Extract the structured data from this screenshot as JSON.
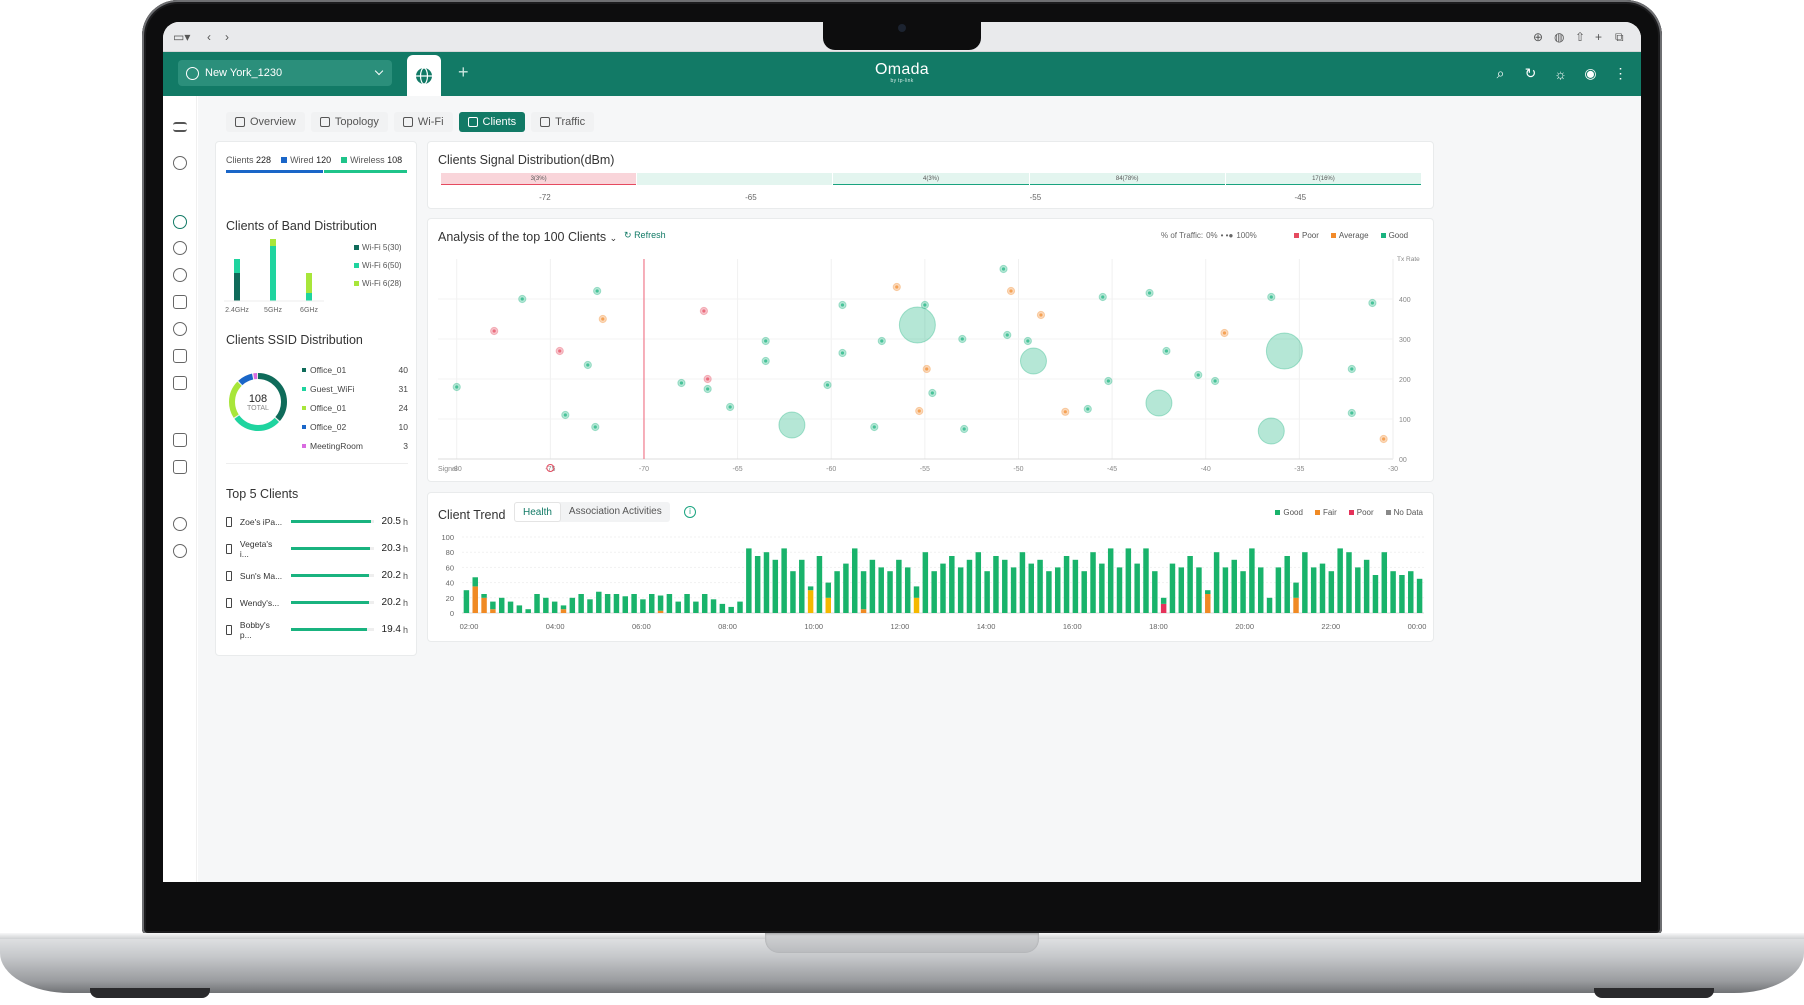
{
  "browser": {
    "controls_left": [
      "sidebar-toggle",
      "back",
      "forward"
    ],
    "controls_right": [
      "download",
      "shield",
      "share",
      "new-tab",
      "tabs"
    ]
  },
  "header": {
    "site": "New York_1230",
    "brand": "Omada",
    "brand_sub": "by tp-link",
    "plus": "+"
  },
  "tabs": [
    {
      "label": "Overview",
      "icon": "grid-icon",
      "active": false
    },
    {
      "label": "Topology",
      "icon": "topology-icon",
      "active": false
    },
    {
      "label": "Wi-Fi",
      "icon": "wifi-icon",
      "active": false
    },
    {
      "label": "Clients",
      "icon": "clients-icon",
      "active": true
    },
    {
      "label": "Traffic",
      "icon": "traffic-icon",
      "active": false
    }
  ],
  "summary": {
    "clients_label": "Clients",
    "clients": "228",
    "wired_label": "Wired",
    "wired": "120",
    "wireless_label": "Wireless",
    "wireless": "108"
  },
  "band": {
    "title": "Clients of Band Distribution",
    "legend": [
      {
        "label": "Wi-Fi 5(30)",
        "color": "#0f6b5a"
      },
      {
        "label": "Wi-Fi 6(50)",
        "color": "#1fd49f"
      },
      {
        "label": "Wi-Fi 6(28)",
        "color": "#a8e63a"
      }
    ],
    "bands": [
      "2.4GHz",
      "5GHz",
      "6GHz"
    ]
  },
  "ssid": {
    "title": "Clients SSID Distribution",
    "total": "108",
    "total_label": "TOTAL",
    "items": [
      {
        "name": "Office_01",
        "value": "40",
        "color": "#0f6b5a"
      },
      {
        "name": "Guest_WiFi",
        "value": "31",
        "color": "#1fd49f"
      },
      {
        "name": "Office_01",
        "value": "24",
        "color": "#a8e63a"
      },
      {
        "name": "Office_02",
        "value": "10",
        "color": "#1a66c8"
      },
      {
        "name": "MeetingRoom",
        "value": "3",
        "color": "#d96be0"
      }
    ]
  },
  "top5": {
    "title": "Top 5 Clients",
    "items": [
      {
        "name": "Zoe's iPa...",
        "value": "20.5",
        "unit": "h",
        "fill": 0.97
      },
      {
        "name": "Vegeta's i...",
        "value": "20.3",
        "unit": "h",
        "fill": 0.96
      },
      {
        "name": "Sun's Ma...",
        "value": "20.2",
        "unit": "h",
        "fill": 0.95
      },
      {
        "name": "Wendy's...",
        "value": "20.2",
        "unit": "h",
        "fill": 0.95
      },
      {
        "name": "Bobby's p...",
        "value": "19.4",
        "unit": "h",
        "fill": 0.92
      }
    ]
  },
  "signal": {
    "title": "Clients Signal Distribution(dBm)",
    "segments": [
      {
        "label": "3(3%)",
        "color": "#f9d5da",
        "line": "#e54a5f"
      },
      {
        "label": "",
        "color": "#e3f5ef",
        "line": "#e3f5ef"
      },
      {
        "label": "4(3%)",
        "color": "#e3f5ef",
        "line": "#19a37f"
      },
      {
        "label": "84(78%)",
        "color": "#e3f5ef",
        "line": "#19a37f"
      },
      {
        "label": "17(16%)",
        "color": "#e3f5ef",
        "line": "#19a37f"
      }
    ],
    "ticks": [
      "-72",
      "-65",
      "-55",
      "-45"
    ]
  },
  "scatter": {
    "title": "Analysis of the top 100 Clients",
    "refresh": "Refresh",
    "traffic_label": "% of Traffic:",
    "traffic_min": "0%",
    "traffic_max": "100%",
    "legend": [
      {
        "label": "Poor",
        "color": "#e54a5f"
      },
      {
        "label": "Average",
        "color": "#f28a2a"
      },
      {
        "label": "Good",
        "color": "#19b37f"
      }
    ],
    "x_label": "Signal",
    "y_label": "Tx Rate",
    "x_ticks": [
      "-80",
      "-75",
      "-70",
      "-65",
      "-60",
      "-55",
      "-50",
      "-45",
      "-40",
      "-35",
      "-30"
    ],
    "y_ticks": [
      "00",
      "100",
      "200",
      "300",
      "400"
    ]
  },
  "chart_data": {
    "type": "scatter",
    "title": "Analysis of the top 100 Clients",
    "xlabel": "Signal",
    "ylabel": "Tx Rate",
    "xlim": [
      -81,
      -30
    ],
    "ylim": [
      0,
      500
    ],
    "threshold_x": -70,
    "points": [
      {
        "x": -80,
        "y": 180,
        "s": 1,
        "q": "good"
      },
      {
        "x": -76.5,
        "y": 400,
        "s": 1,
        "q": "good"
      },
      {
        "x": -78,
        "y": 320,
        "s": 1,
        "q": "poor"
      },
      {
        "x": -74.5,
        "y": 270,
        "s": 1,
        "q": "poor"
      },
      {
        "x": -74.2,
        "y": 110,
        "s": 1,
        "q": "good"
      },
      {
        "x": -73,
        "y": 235,
        "s": 1,
        "q": "good"
      },
      {
        "x": -72.5,
        "y": 420,
        "s": 1,
        "q": "good"
      },
      {
        "x": -72.2,
        "y": 350,
        "s": 1,
        "q": "average"
      },
      {
        "x": -72.6,
        "y": 80,
        "s": 1,
        "q": "good"
      },
      {
        "x": -68,
        "y": 190,
        "s": 1,
        "q": "good"
      },
      {
        "x": -66.8,
        "y": 370,
        "s": 1,
        "q": "poor"
      },
      {
        "x": -66.6,
        "y": 200,
        "s": 1,
        "q": "poor"
      },
      {
        "x": -66.6,
        "y": 175,
        "s": 1,
        "q": "good"
      },
      {
        "x": -65.4,
        "y": 130,
        "s": 1,
        "q": "good"
      },
      {
        "x": -63.5,
        "y": 295,
        "s": 1,
        "q": "good"
      },
      {
        "x": -63.5,
        "y": 245,
        "s": 1,
        "q": "good"
      },
      {
        "x": -62.1,
        "y": 85,
        "s": 3,
        "q": "good"
      },
      {
        "x": -60.2,
        "y": 185,
        "s": 1,
        "q": "good"
      },
      {
        "x": -59.4,
        "y": 385,
        "s": 1,
        "q": "good"
      },
      {
        "x": -59.4,
        "y": 265,
        "s": 1,
        "q": "good"
      },
      {
        "x": -57.3,
        "y": 295,
        "s": 1,
        "q": "good"
      },
      {
        "x": -57.7,
        "y": 80,
        "s": 1,
        "q": "good"
      },
      {
        "x": -56.5,
        "y": 430,
        "s": 1,
        "q": "average"
      },
      {
        "x": -55.4,
        "y": 335,
        "s": 4,
        "q": "good"
      },
      {
        "x": -55,
        "y": 385,
        "s": 1,
        "q": "good"
      },
      {
        "x": -54.9,
        "y": 225,
        "s": 1,
        "q": "average"
      },
      {
        "x": -55.3,
        "y": 120,
        "s": 1,
        "q": "average"
      },
      {
        "x": -54.6,
        "y": 165,
        "s": 1,
        "q": "good"
      },
      {
        "x": -53,
        "y": 300,
        "s": 1,
        "q": "good"
      },
      {
        "x": -52.9,
        "y": 75,
        "s": 1,
        "q": "good"
      },
      {
        "x": -50.8,
        "y": 475,
        "s": 1,
        "q": "good"
      },
      {
        "x": -50.6,
        "y": 310,
        "s": 1,
        "q": "good"
      },
      {
        "x": -50.4,
        "y": 420,
        "s": 1,
        "q": "average"
      },
      {
        "x": -48.8,
        "y": 360,
        "s": 1,
        "q": "average"
      },
      {
        "x": -49.5,
        "y": 295,
        "s": 1,
        "q": "good"
      },
      {
        "x": -49.2,
        "y": 245,
        "s": 3,
        "q": "good"
      },
      {
        "x": -47.5,
        "y": 118,
        "s": 1,
        "q": "average"
      },
      {
        "x": -46.3,
        "y": 125,
        "s": 1,
        "q": "good"
      },
      {
        "x": -45.5,
        "y": 405,
        "s": 1,
        "q": "good"
      },
      {
        "x": -45.2,
        "y": 195,
        "s": 1,
        "q": "good"
      },
      {
        "x": -42.5,
        "y": 140,
        "s": 3,
        "q": "good"
      },
      {
        "x": -42.1,
        "y": 270,
        "s": 1,
        "q": "good"
      },
      {
        "x": -43,
        "y": 415,
        "s": 1,
        "q": "good"
      },
      {
        "x": -40.4,
        "y": 210,
        "s": 1,
        "q": "good"
      },
      {
        "x": -39.5,
        "y": 195,
        "s": 1,
        "q": "good"
      },
      {
        "x": -39,
        "y": 315,
        "s": 1,
        "q": "average"
      },
      {
        "x": -36.5,
        "y": 405,
        "s": 1,
        "q": "good"
      },
      {
        "x": -36.5,
        "y": 70,
        "s": 3,
        "q": "good"
      },
      {
        "x": -35.8,
        "y": 270,
        "s": 4,
        "q": "good"
      },
      {
        "x": -32.2,
        "y": 225,
        "s": 1,
        "q": "good"
      },
      {
        "x": -32.2,
        "y": 115,
        "s": 1,
        "q": "good"
      },
      {
        "x": -31.1,
        "y": 390,
        "s": 1,
        "q": "good"
      },
      {
        "x": -30.5,
        "y": 50,
        "s": 1,
        "q": "average"
      }
    ]
  },
  "trend": {
    "title": "Client Trend",
    "tabs": [
      {
        "label": "Health",
        "active": true
      },
      {
        "label": "Association Activities",
        "active": false
      }
    ],
    "legend": [
      {
        "label": "Good",
        "color": "#19b36b"
      },
      {
        "label": "Fair",
        "color": "#f08a24"
      },
      {
        "label": "Poor",
        "color": "#e5325a"
      },
      {
        "label": "No Data",
        "color": "#888"
      }
    ],
    "y_ticks": [
      "100",
      "80",
      "60",
      "40",
      "20",
      "0"
    ],
    "x_ticks": [
      "02:00",
      "04:00",
      "06:00",
      "08:00",
      "10:00",
      "12:00",
      "14:00",
      "16:00",
      "18:00",
      "20:00",
      "22:00",
      "00:00"
    ],
    "bars": [
      {
        "g": 30,
        "f": 0,
        "y": 0,
        "p": 0
      },
      {
        "g": 12,
        "f": 35,
        "y": 0,
        "p": 0
      },
      {
        "g": 5,
        "f": 20,
        "y": 0,
        "p": 0
      },
      {
        "g": 10,
        "f": 5,
        "y": 0,
        "p": 0
      },
      {
        "g": 20,
        "f": 0,
        "y": 0,
        "p": 0
      },
      {
        "g": 15,
        "f": 0,
        "y": 0,
        "p": 0
      },
      {
        "g": 10,
        "f": 0,
        "y": 0,
        "p": 0
      },
      {
        "g": 5,
        "f": 0,
        "y": 0,
        "p": 0
      },
      {
        "g": 25,
        "f": 0,
        "y": 0,
        "p": 0
      },
      {
        "g": 20,
        "f": 0,
        "y": 0,
        "p": 0
      },
      {
        "g": 15,
        "f": 0,
        "y": 0,
        "p": 0
      },
      {
        "g": 5,
        "f": 5,
        "y": 0,
        "p": 0
      },
      {
        "g": 20,
        "f": 0,
        "y": 0,
        "p": 0
      },
      {
        "g": 25,
        "f": 0,
        "y": 0,
        "p": 0
      },
      {
        "g": 18,
        "f": 0,
        "y": 0,
        "p": 0
      },
      {
        "g": 28,
        "f": 0,
        "y": 0,
        "p": 0
      },
      {
        "g": 25,
        "f": 0,
        "y": 0,
        "p": 0
      },
      {
        "g": 25,
        "f": 0,
        "y": 0,
        "p": 0
      },
      {
        "g": 22,
        "f": 0,
        "y": 0,
        "p": 0
      },
      {
        "g": 25,
        "f": 0,
        "y": 0,
        "p": 0
      },
      {
        "g": 18,
        "f": 0,
        "y": 0,
        "p": 0
      },
      {
        "g": 25,
        "f": 0,
        "y": 0,
        "p": 0
      },
      {
        "g": 20,
        "f": 3,
        "y": 0,
        "p": 0
      },
      {
        "g": 25,
        "f": 0,
        "y": 0,
        "p": 0
      },
      {
        "g": 15,
        "f": 0,
        "y": 0,
        "p": 0
      },
      {
        "g": 25,
        "f": 0,
        "y": 0,
        "p": 0
      },
      {
        "g": 15,
        "f": 0,
        "y": 0,
        "p": 0
      },
      {
        "g": 25,
        "f": 0,
        "y": 0,
        "p": 0
      },
      {
        "g": 18,
        "f": 0,
        "y": 0,
        "p": 0
      },
      {
        "g": 12,
        "f": 0,
        "y": 0,
        "p": 0
      },
      {
        "g": 8,
        "f": 0,
        "y": 0,
        "p": 0
      },
      {
        "g": 15,
        "f": 0,
        "y": 0,
        "p": 0
      },
      {
        "g": 85,
        "f": 0,
        "y": 0,
        "p": 0
      },
      {
        "g": 75,
        "f": 0,
        "y": 0,
        "p": 0
      },
      {
        "g": 80,
        "f": 0,
        "y": 0,
        "p": 0
      },
      {
        "g": 70,
        "f": 0,
        "y": 0,
        "p": 0
      },
      {
        "g": 85,
        "f": 0,
        "y": 0,
        "p": 0
      },
      {
        "g": 55,
        "f": 0,
        "y": 0,
        "p": 0
      },
      {
        "g": 70,
        "f": 0,
        "y": 0,
        "p": 0
      },
      {
        "g": 5,
        "f": 0,
        "y": 30,
        "p": 0
      },
      {
        "g": 75,
        "f": 0,
        "y": 0,
        "p": 0
      },
      {
        "g": 20,
        "f": 0,
        "y": 20,
        "p": 0
      },
      {
        "g": 55,
        "f": 0,
        "y": 0,
        "p": 0
      },
      {
        "g": 65,
        "f": 0,
        "y": 0,
        "p": 0
      },
      {
        "g": 85,
        "f": 0,
        "y": 0,
        "p": 0
      },
      {
        "g": 50,
        "f": 5,
        "y": 0,
        "p": 0
      },
      {
        "g": 70,
        "f": 0,
        "y": 0,
        "p": 0
      },
      {
        "g": 60,
        "f": 0,
        "y": 0,
        "p": 0
      },
      {
        "g": 55,
        "f": 0,
        "y": 0,
        "p": 0
      },
      {
        "g": 70,
        "f": 0,
        "y": 0,
        "p": 0
      },
      {
        "g": 60,
        "f": 0,
        "y": 0,
        "p": 0
      },
      {
        "g": 15,
        "f": 0,
        "y": 20,
        "p": 0
      },
      {
        "g": 80,
        "f": 0,
        "y": 0,
        "p": 0
      },
      {
        "g": 55,
        "f": 0,
        "y": 0,
        "p": 0
      },
      {
        "g": 65,
        "f": 0,
        "y": 0,
        "p": 0
      },
      {
        "g": 75,
        "f": 0,
        "y": 0,
        "p": 0
      },
      {
        "g": 60,
        "f": 0,
        "y": 0,
        "p": 0
      },
      {
        "g": 70,
        "f": 0,
        "y": 0,
        "p": 0
      },
      {
        "g": 80,
        "f": 0,
        "y": 0,
        "p": 0
      },
      {
        "g": 55,
        "f": 0,
        "y": 0,
        "p": 0
      },
      {
        "g": 75,
        "f": 0,
        "y": 0,
        "p": 0
      },
      {
        "g": 70,
        "f": 0,
        "y": 0,
        "p": 0
      },
      {
        "g": 60,
        "f": 0,
        "y": 0,
        "p": 0
      },
      {
        "g": 80,
        "f": 0,
        "y": 0,
        "p": 0
      },
      {
        "g": 65,
        "f": 0,
        "y": 0,
        "p": 0
      },
      {
        "g": 70,
        "f": 0,
        "y": 0,
        "p": 0
      },
      {
        "g": 55,
        "f": 0,
        "y": 0,
        "p": 0
      },
      {
        "g": 60,
        "f": 0,
        "y": 0,
        "p": 0
      },
      {
        "g": 75,
        "f": 0,
        "y": 0,
        "p": 0
      },
      {
        "g": 70,
        "f": 0,
        "y": 0,
        "p": 0
      },
      {
        "g": 55,
        "f": 0,
        "y": 0,
        "p": 0
      },
      {
        "g": 80,
        "f": 0,
        "y": 0,
        "p": 0
      },
      {
        "g": 65,
        "f": 0,
        "y": 0,
        "p": 0
      },
      {
        "g": 85,
        "f": 0,
        "y": 0,
        "p": 0
      },
      {
        "g": 60,
        "f": 0,
        "y": 0,
        "p": 0
      },
      {
        "g": 85,
        "f": 0,
        "y": 0,
        "p": 0
      },
      {
        "g": 65,
        "f": 0,
        "y": 0,
        "p": 0
      },
      {
        "g": 85,
        "f": 0,
        "y": 0,
        "p": 0
      },
      {
        "g": 55,
        "f": 0,
        "y": 0,
        "p": 0
      },
      {
        "g": 8,
        "f": 0,
        "y": 0,
        "p": 12
      },
      {
        "g": 65,
        "f": 0,
        "y": 0,
        "p": 0
      },
      {
        "g": 60,
        "f": 0,
        "y": 0,
        "p": 0
      },
      {
        "g": 75,
        "f": 0,
        "y": 0,
        "p": 0
      },
      {
        "g": 60,
        "f": 0,
        "y": 0,
        "p": 0
      },
      {
        "g": 5,
        "f": 25,
        "y": 0,
        "p": 0
      },
      {
        "g": 80,
        "f": 0,
        "y": 0,
        "p": 0
      },
      {
        "g": 60,
        "f": 0,
        "y": 0,
        "p": 0
      },
      {
        "g": 70,
        "f": 0,
        "y": 0,
        "p": 0
      },
      {
        "g": 55,
        "f": 0,
        "y": 0,
        "p": 0
      },
      {
        "g": 85,
        "f": 0,
        "y": 0,
        "p": 0
      },
      {
        "g": 60,
        "f": 0,
        "y": 0,
        "p": 0
      },
      {
        "g": 20,
        "f": 0,
        "y": 0,
        "p": 0
      },
      {
        "g": 60,
        "f": 0,
        "y": 0,
        "p": 0
      },
      {
        "g": 75,
        "f": 0,
        "y": 0,
        "p": 0
      },
      {
        "g": 20,
        "f": 20,
        "y": 0,
        "p": 0
      },
      {
        "g": 80,
        "f": 0,
        "y": 0,
        "p": 0
      },
      {
        "g": 60,
        "f": 0,
        "y": 0,
        "p": 0
      },
      {
        "g": 65,
        "f": 0,
        "y": 0,
        "p": 0
      },
      {
        "g": 55,
        "f": 0,
        "y": 0,
        "p": 0
      },
      {
        "g": 85,
        "f": 0,
        "y": 0,
        "p": 0
      },
      {
        "g": 80,
        "f": 0,
        "y": 0,
        "p": 0
      },
      {
        "g": 60,
        "f": 0,
        "y": 0,
        "p": 0
      },
      {
        "g": 70,
        "f": 0,
        "y": 0,
        "p": 0
      },
      {
        "g": 50,
        "f": 0,
        "y": 0,
        "p": 0
      },
      {
        "g": 80,
        "f": 0,
        "y": 0,
        "p": 0
      },
      {
        "g": 55,
        "f": 0,
        "y": 0,
        "p": 0
      },
      {
        "g": 50,
        "f": 0,
        "y": 0,
        "p": 0
      },
      {
        "g": 55,
        "f": 0,
        "y": 0,
        "p": 0
      },
      {
        "g": 45,
        "f": 0,
        "y": 0,
        "p": 0
      }
    ]
  }
}
